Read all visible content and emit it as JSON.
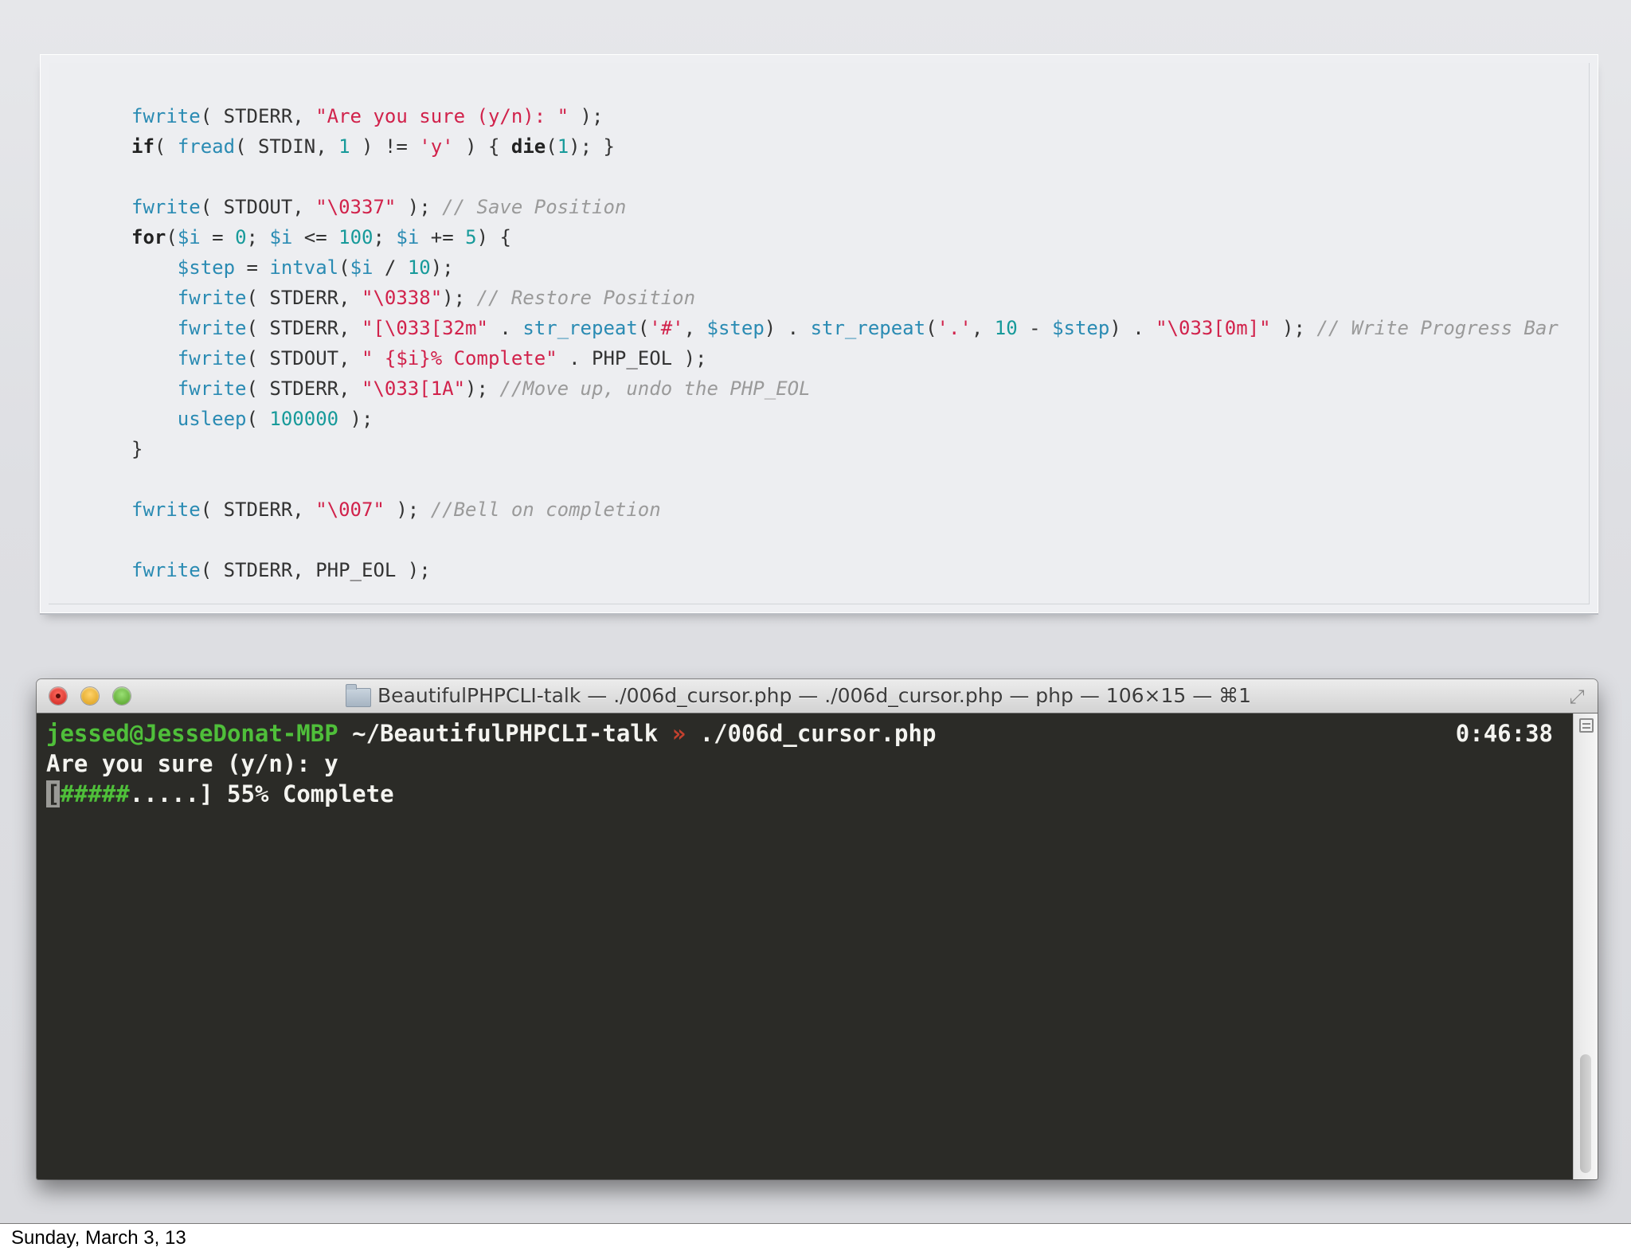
{
  "code": {
    "lines": [
      [
        [
          "fn",
          "fwrite"
        ],
        [
          "pl",
          "( STDERR, "
        ],
        [
          "str",
          "\"Are you sure (y/n): \""
        ],
        [
          "pl",
          " );"
        ]
      ],
      [
        [
          "kw",
          "if"
        ],
        [
          "pl",
          "( "
        ],
        [
          "fn",
          "fread"
        ],
        [
          "pl",
          "( STDIN, "
        ],
        [
          "num",
          "1"
        ],
        [
          "pl",
          " ) != "
        ],
        [
          "str",
          "'y'"
        ],
        [
          "pl",
          " ) { "
        ],
        [
          "kw",
          "die"
        ],
        [
          "pl",
          "("
        ],
        [
          "num",
          "1"
        ],
        [
          "pl",
          "); }"
        ]
      ],
      [],
      [
        [
          "fn",
          "fwrite"
        ],
        [
          "pl",
          "( STDOUT, "
        ],
        [
          "str",
          "\"\\0337\""
        ],
        [
          "pl",
          " ); "
        ],
        [
          "com",
          "// Save Position"
        ]
      ],
      [
        [
          "kw",
          "for"
        ],
        [
          "pl",
          "("
        ],
        [
          "var",
          "$i"
        ],
        [
          "pl",
          " = "
        ],
        [
          "num",
          "0"
        ],
        [
          "pl",
          "; "
        ],
        [
          "var",
          "$i"
        ],
        [
          "pl",
          " <= "
        ],
        [
          "num",
          "100"
        ],
        [
          "pl",
          "; "
        ],
        [
          "var",
          "$i"
        ],
        [
          "pl",
          " += "
        ],
        [
          "num",
          "5"
        ],
        [
          "pl",
          ") {"
        ]
      ],
      [
        [
          "pl",
          "    "
        ],
        [
          "var",
          "$step"
        ],
        [
          "pl",
          " = "
        ],
        [
          "fn",
          "intval"
        ],
        [
          "pl",
          "("
        ],
        [
          "var",
          "$i"
        ],
        [
          "pl",
          " / "
        ],
        [
          "num",
          "10"
        ],
        [
          "pl",
          ");"
        ]
      ],
      [
        [
          "pl",
          "    "
        ],
        [
          "fn",
          "fwrite"
        ],
        [
          "pl",
          "( STDERR, "
        ],
        [
          "str",
          "\"\\0338\""
        ],
        [
          "pl",
          "); "
        ],
        [
          "com",
          "// Restore Position"
        ]
      ],
      [
        [
          "pl",
          "    "
        ],
        [
          "fn",
          "fwrite"
        ],
        [
          "pl",
          "( STDERR, "
        ],
        [
          "str",
          "\"[\\033[32m\""
        ],
        [
          "pl",
          " . "
        ],
        [
          "fn",
          "str_repeat"
        ],
        [
          "pl",
          "("
        ],
        [
          "str",
          "'#'"
        ],
        [
          "pl",
          ", "
        ],
        [
          "var",
          "$step"
        ],
        [
          "pl",
          ") . "
        ],
        [
          "fn",
          "str_repeat"
        ],
        [
          "pl",
          "("
        ],
        [
          "str",
          "'.'"
        ],
        [
          "pl",
          ", "
        ],
        [
          "num",
          "10"
        ],
        [
          "pl",
          " - "
        ],
        [
          "var",
          "$step"
        ],
        [
          "pl",
          ") . "
        ],
        [
          "str",
          "\"\\033[0m]\""
        ],
        [
          "pl",
          " ); "
        ],
        [
          "com",
          "// Write Progress Bar"
        ]
      ],
      [
        [
          "pl",
          "    "
        ],
        [
          "fn",
          "fwrite"
        ],
        [
          "pl",
          "( STDOUT, "
        ],
        [
          "str",
          "\" {$i}% Complete\""
        ],
        [
          "pl",
          " . PHP_EOL );"
        ]
      ],
      [
        [
          "pl",
          "    "
        ],
        [
          "fn",
          "fwrite"
        ],
        [
          "pl",
          "( STDERR, "
        ],
        [
          "str",
          "\"\\033[1A\""
        ],
        [
          "pl",
          "); "
        ],
        [
          "com",
          "//Move up, undo the PHP_EOL"
        ]
      ],
      [
        [
          "pl",
          "    "
        ],
        [
          "fn",
          "usleep"
        ],
        [
          "pl",
          "( "
        ],
        [
          "num",
          "100000"
        ],
        [
          "pl",
          " );"
        ]
      ],
      [
        [
          "pl",
          "}"
        ]
      ],
      [],
      [
        [
          "fn",
          "fwrite"
        ],
        [
          "pl",
          "( STDERR, "
        ],
        [
          "str",
          "\"\\007\""
        ],
        [
          "pl",
          " ); "
        ],
        [
          "com",
          "//Bell on completion"
        ]
      ],
      [],
      [
        [
          "fn",
          "fwrite"
        ],
        [
          "pl",
          "( STDERR, PHP_EOL );"
        ]
      ]
    ]
  },
  "terminal": {
    "title": "BeautifulPHPCLI-talk — ./006d_cursor.php — ./006d_cursor.php — php — 106×15 — ⌘1",
    "prompt_user": "jessed@JesseDonat-MBP",
    "prompt_path": " ~/BeautifulPHPCLI-talk",
    "prompt_arrow": " »",
    "prompt_command": " ./006d_cursor.php",
    "clock": "0:46:38",
    "line2": "Are you sure (y/n): y",
    "bar_open": "[",
    "bar_hashes": "#####",
    "bar_dots": ".....",
    "bar_close": "]",
    "progress_text": " 55% Complete",
    "progress_percent": 55,
    "scroll_fraction": 0.5,
    "resize_icon": "resize-icon"
  },
  "footer": {
    "date": "Sunday, March 3, 13"
  },
  "colors": {
    "function": "#2a8bb3",
    "string": "#d1224b",
    "number": "#179a9a",
    "comment": "#9a9a9a",
    "terminal_bg": "#2b2b27",
    "terminal_green": "#4fbf3a"
  }
}
